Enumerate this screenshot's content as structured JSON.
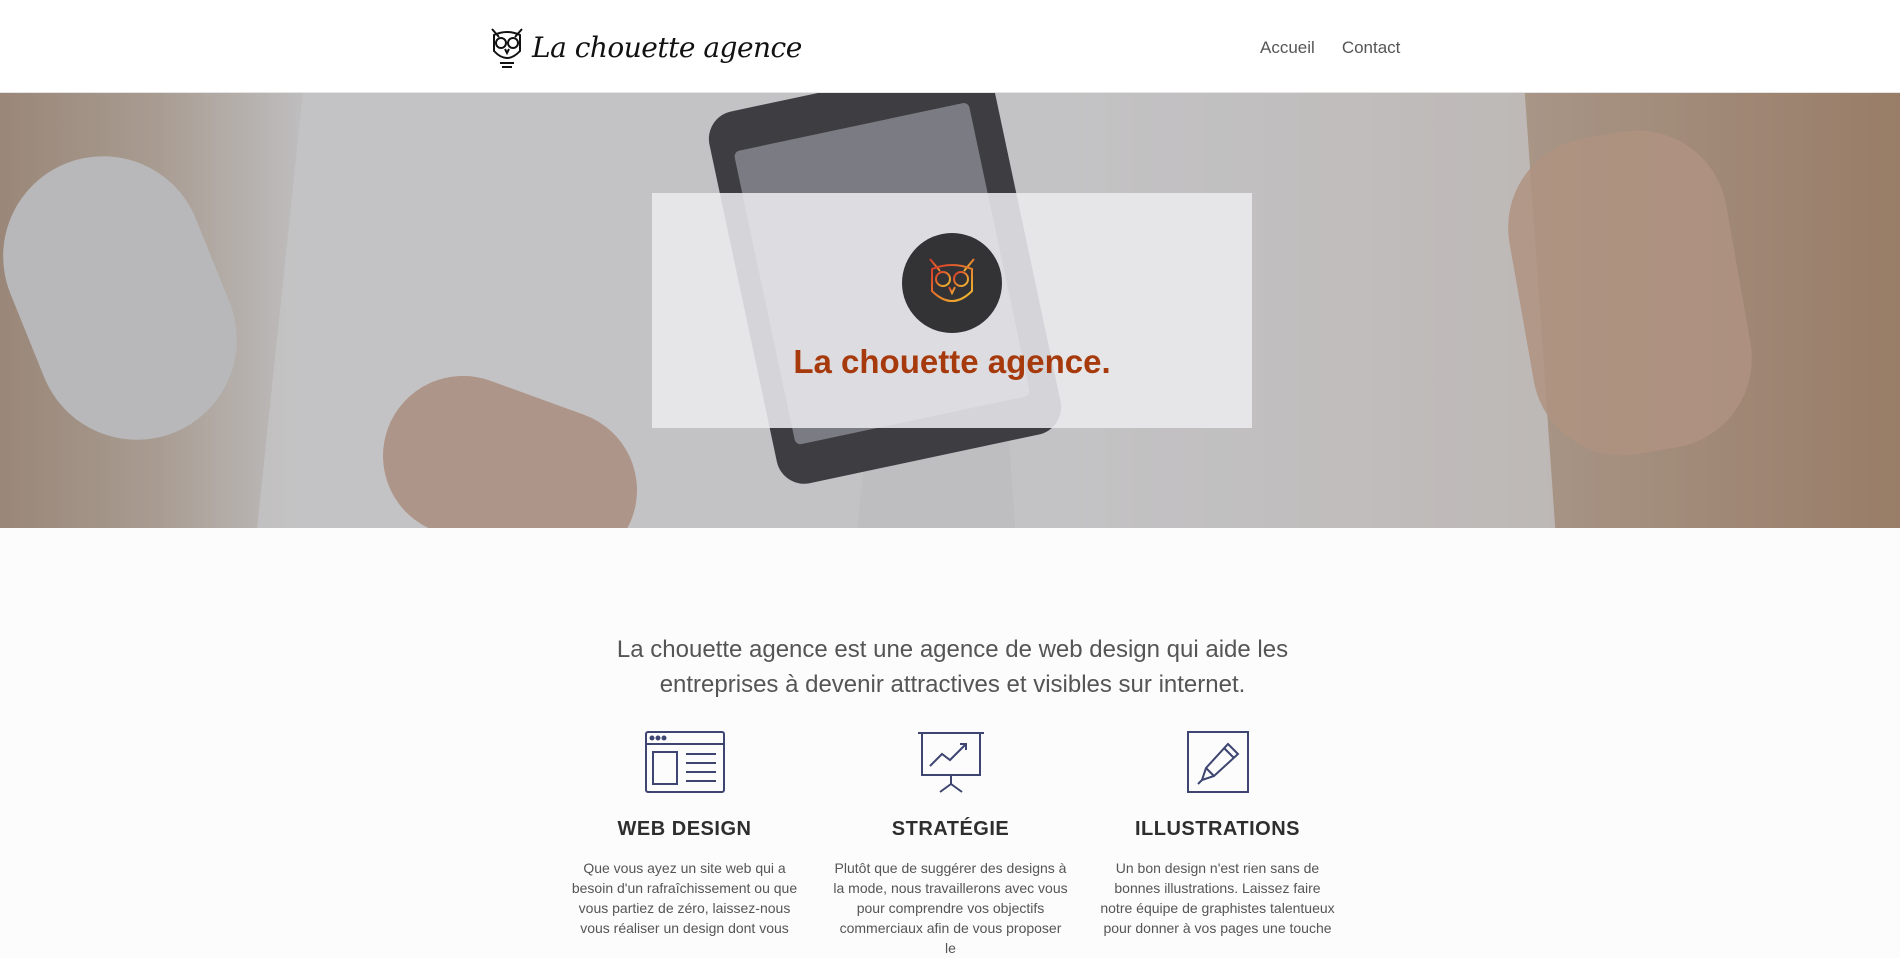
{
  "header": {
    "brand_name": "La chouette agence",
    "nav": [
      {
        "label": "Accueil"
      },
      {
        "label": "Contact"
      }
    ]
  },
  "hero": {
    "title": "La chouette agence."
  },
  "intro": {
    "text": "La chouette agence est une agence de web design qui aide les entreprises à devenir attractives et visibles sur internet."
  },
  "services": [
    {
      "icon": "web-layout-icon",
      "title": "WEB DESIGN",
      "text": "Que vous ayez un site web qui a besoin d'un rafraîchissement ou que vous partiez de zéro, laissez-nous vous réaliser un design dont vous"
    },
    {
      "icon": "presentation-chart-icon",
      "title": "STRATÉGIE",
      "text": "Plutôt que de suggérer des designs à la mode, nous travaillerons avec vous pour comprendre vos objectifs commerciaux afin de vous proposer le"
    },
    {
      "icon": "pencil-icon",
      "title": "ILLUSTRATIONS",
      "text": "Un bon design n'est rien sans de bonnes illustrations. Laissez faire notre équipe de graphistes talentueux pour donner à vos pages une touche"
    }
  ],
  "colors": {
    "accent": "#a63a0c",
    "icon_stroke": "#3d4570",
    "hero_logo_bg": "#333336"
  }
}
